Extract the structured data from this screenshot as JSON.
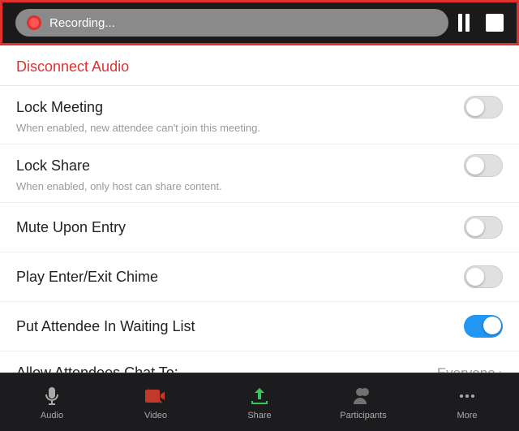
{
  "recording_bar": {
    "label": "Recording...",
    "pause_label": "pause",
    "stop_label": "stop"
  },
  "disconnect": {
    "label": "Disconnect Audio"
  },
  "settings": [
    {
      "id": "lock-meeting",
      "label": "Lock Meeting",
      "desc": "When enabled, new attendee can't join this meeting.",
      "enabled": false
    },
    {
      "id": "lock-share",
      "label": "Lock Share",
      "desc": "When enabled, only host can share content.",
      "enabled": false
    },
    {
      "id": "mute-upon-entry",
      "label": "Mute Upon Entry",
      "desc": null,
      "enabled": false
    },
    {
      "id": "play-chime",
      "label": "Play Enter/Exit Chime",
      "desc": null,
      "enabled": false
    },
    {
      "id": "waiting-list",
      "label": "Put Attendee In Waiting List",
      "desc": null,
      "enabled": true
    }
  ],
  "chat": {
    "label": "Allow Attendees Chat To:",
    "value": "Everyone"
  },
  "tabs": [
    {
      "id": "audio",
      "label": "Audio"
    },
    {
      "id": "video",
      "label": "Video"
    },
    {
      "id": "share",
      "label": "Share"
    },
    {
      "id": "participants",
      "label": "Participants"
    },
    {
      "id": "more",
      "label": "More"
    }
  ]
}
